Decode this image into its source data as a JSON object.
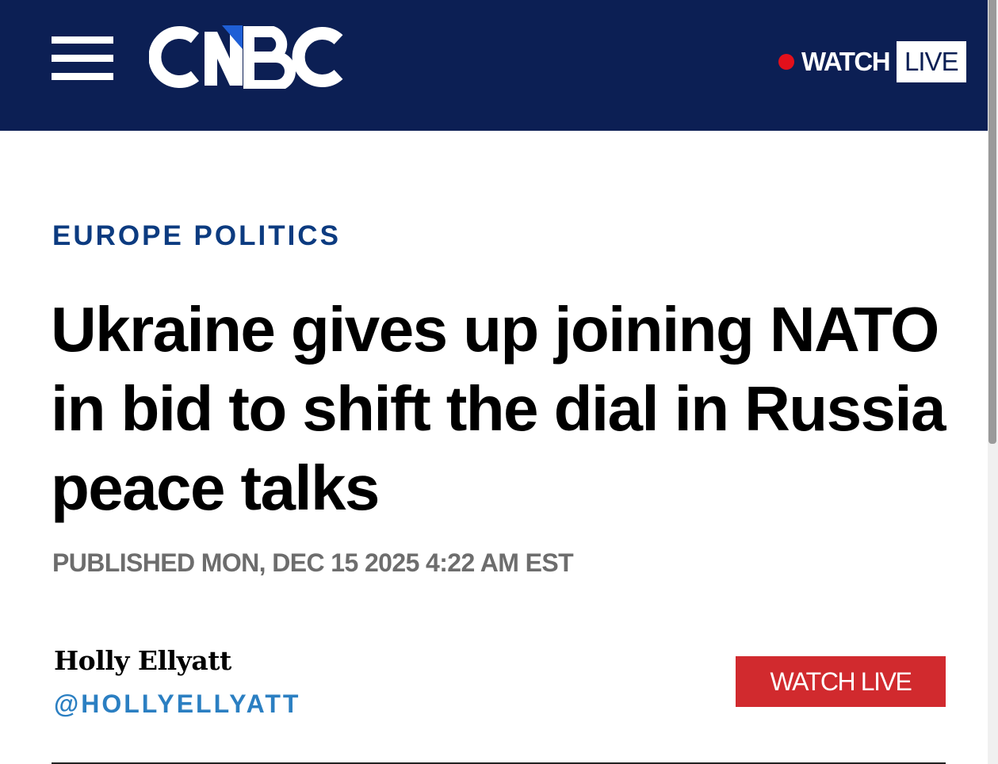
{
  "header": {
    "logo_text": "CNBC",
    "watch_label": "WATCH",
    "live_label": "LIVE",
    "background_color": "#0c1f54",
    "live_dot_color": "#e3101b"
  },
  "article": {
    "kicker": "EUROPE POLITICS",
    "headline": "Ukraine gives up joining NATO in bid to shift the dial in Russia peace talks",
    "published": "PUBLISHED MON, DEC 15 2025 4:22 AM EST"
  },
  "author": {
    "name": "Holly Ellyatt",
    "handle": "@HOLLYELLYATT"
  },
  "watch_live_button": {
    "label": "WATCH LIVE",
    "color": "#d12a2e"
  },
  "icons": {
    "menu": "hamburger-menu-icon",
    "live": "live-dot-icon"
  }
}
